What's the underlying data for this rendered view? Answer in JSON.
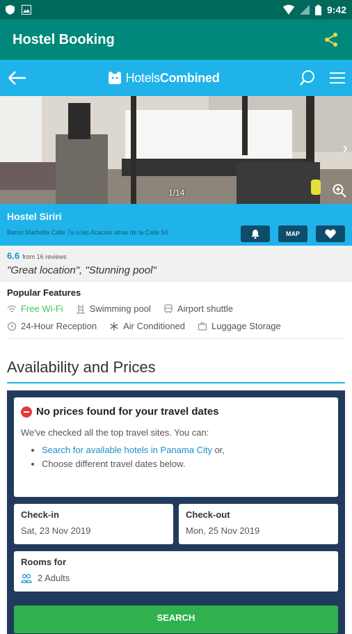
{
  "status_bar": {
    "time": "9:42"
  },
  "app_bar": {
    "title": "Hostel Booking",
    "share_icon": "share-icon"
  },
  "hc_bar": {
    "logo_left": "Hotels",
    "logo_right": "Combined"
  },
  "photo": {
    "counter": "1/14"
  },
  "hotel": {
    "name": "Hostel Siriri",
    "address": "Barrio Marbella Calle 7a u las Acacias atras de la Calle 50",
    "buttons": {
      "map": "MAP"
    }
  },
  "rating": {
    "score": "6.6",
    "reviews": "from 16 reviews",
    "quote": "\"Great location\", \"Stunning pool\""
  },
  "features": {
    "heading": "Popular Features",
    "row1": [
      {
        "label": "Free Wi-Fi",
        "icon": "wifi-icon"
      },
      {
        "label": "Swimming pool",
        "icon": "pool-icon"
      },
      {
        "label": "Airport shuttle",
        "icon": "shuttle-icon"
      }
    ],
    "row2": [
      {
        "label": "24-Hour Reception",
        "icon": "clock-icon"
      },
      {
        "label": "Air Conditioned",
        "icon": "snowflake-icon"
      },
      {
        "label": "Luggage Storage",
        "icon": "luggage-icon"
      }
    ]
  },
  "availability": {
    "title": "Availability and Prices",
    "notice_title": "No prices found for your travel dates",
    "notice_sub": "We've checked all the top travel sites. You can:",
    "option1_link": "Search for available hotels in Panama City",
    "option1_suffix": " or,",
    "option2": "Choose different travel dates below.",
    "checkin_label": "Check-in",
    "checkin_value": "Sat, 23 Nov 2019",
    "checkout_label": "Check-out",
    "checkout_value": "Mon, 25 Nov 2019",
    "rooms_label": "Rooms for",
    "rooms_value": "2 Adults",
    "search_label": "SEARCH"
  }
}
